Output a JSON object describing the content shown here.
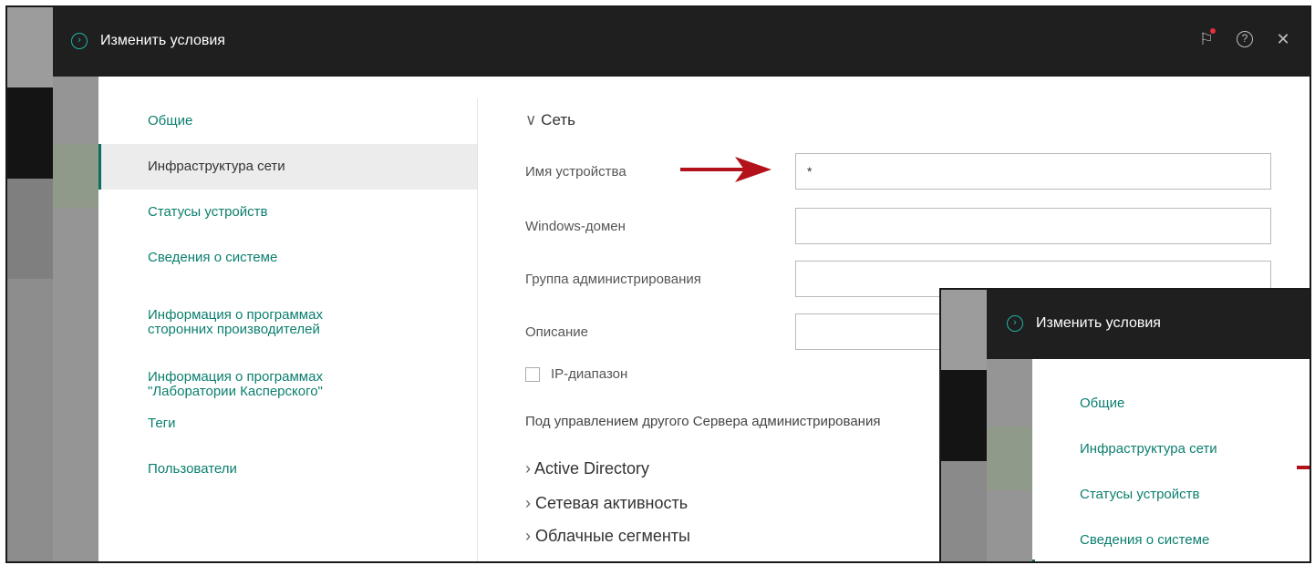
{
  "dialog": {
    "title": "Изменить условия"
  },
  "sidebar": {
    "items": [
      {
        "label": "Общие",
        "active": false
      },
      {
        "label": "Инфраструктура сети",
        "active": true
      },
      {
        "label": "Статусы устройств",
        "active": false
      },
      {
        "label": "Сведения о системе",
        "active": false
      },
      {
        "label": "Информация о программах\nсторонних производителей",
        "active": false
      },
      {
        "label": "Информация о программах\n\"Лаборатории Касперского\"",
        "active": false
      },
      {
        "label": "Теги",
        "active": false
      },
      {
        "label": "Пользователи",
        "active": false
      }
    ]
  },
  "section": {
    "title": "Сеть",
    "fields": [
      {
        "label": "Имя устройства",
        "value": "*"
      },
      {
        "label": "Windows-домен",
        "value": ""
      },
      {
        "label": "Группа администрирования",
        "value": ""
      },
      {
        "label": "Описание",
        "value": ""
      }
    ],
    "ip_range_label": "IP-диапазон",
    "managed_label": "Под управлением другого Сервера администрирования",
    "expanders": [
      "Active Directory",
      "Сетевая активность",
      "Облачные сегменты"
    ]
  },
  "overlay": {
    "title": "Изменить условия",
    "items": [
      "Общие",
      "Инфраструктура сети",
      "Статусы устройств",
      "Сведения о системе"
    ]
  },
  "colors": {
    "accent": "#0b7f6e",
    "header_bg": "#1f1f1f",
    "arrow": "#b3121b",
    "notify_dot": "#e0303a"
  },
  "icons": {
    "header_left": "chevron-circle-icon",
    "flag": "flag-icon",
    "help": "help-icon",
    "close": "close-icon"
  }
}
